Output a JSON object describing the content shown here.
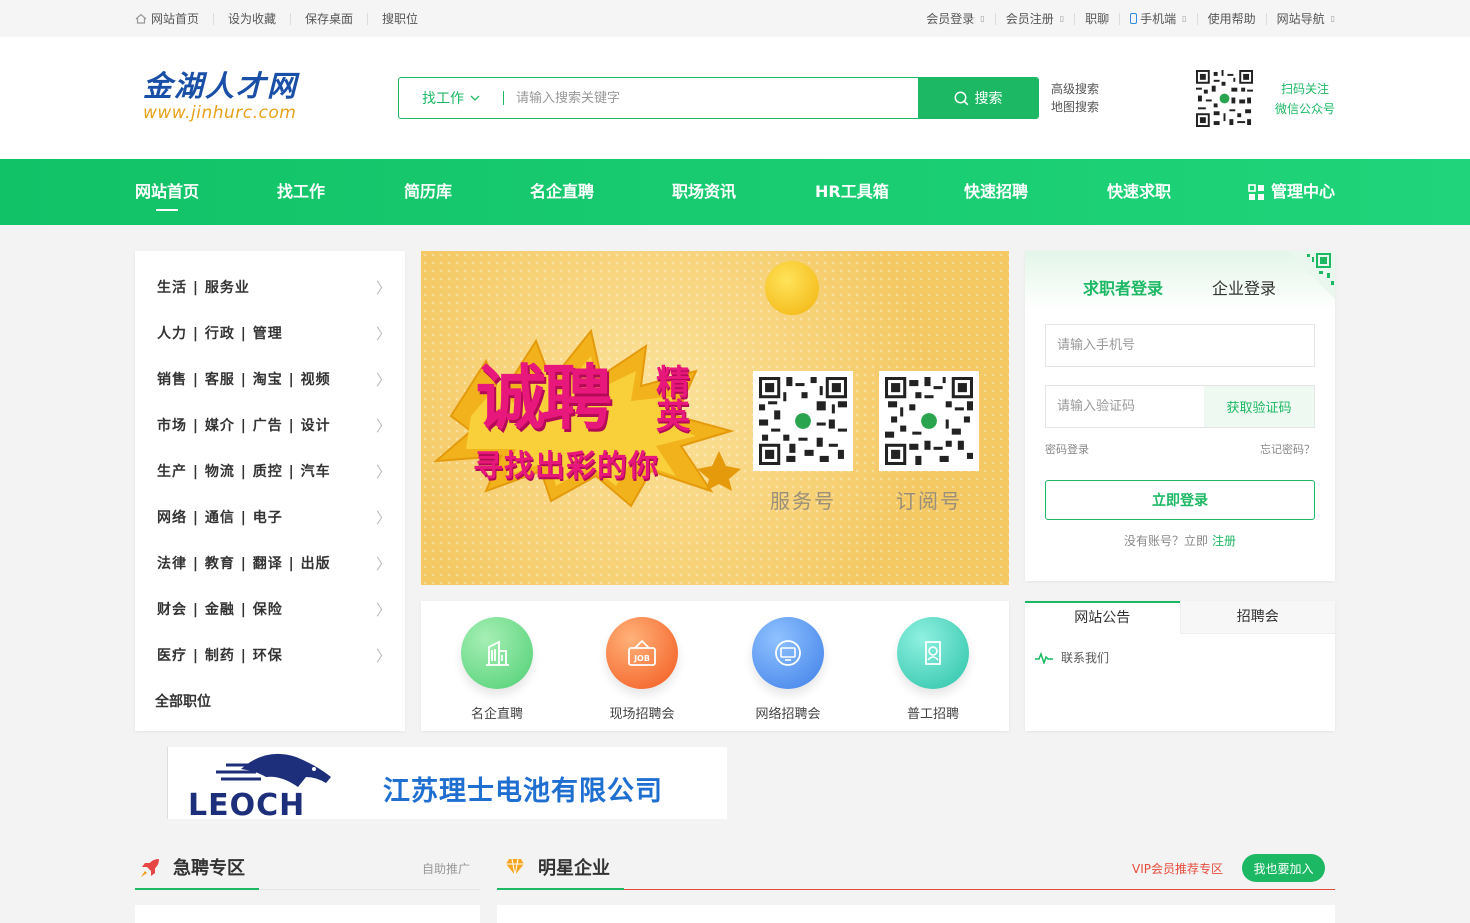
{
  "topbar": {
    "left": [
      "网站首页",
      "设为收藏",
      "保存桌面",
      "搜职位"
    ],
    "right": [
      "会员登录",
      "会员注册",
      "职聊",
      "手机端",
      "使用帮助",
      "网站导航"
    ]
  },
  "logo": {
    "cn": "金湖人才网",
    "en": "www.jinhurc.com"
  },
  "search": {
    "type": "找工作",
    "placeholder": "请输入搜索关键字",
    "button": "搜索",
    "advanced": "高级搜索",
    "map": "地图搜索"
  },
  "scan": {
    "line1": "扫码关注",
    "line2": "微信公众号"
  },
  "nav": [
    "网站首页",
    "找工作",
    "简历库",
    "名企直聘",
    "职场资讯",
    "HR工具箱",
    "快速招聘",
    "快速求职",
    "管理中心"
  ],
  "categories": [
    "生活 | 服务业",
    "人力 | 行政 | 管理",
    "销售 | 客服 | 淘宝 | 视频",
    "市场 | 媒介 | 广告 | 设计",
    "生产 | 物流 | 质控 | 汽车",
    "网络 | 通信 | 电子",
    "法律 | 教育 | 翻译 | 出版",
    "财会 | 金融 | 保险",
    "医疗 | 制药 | 环保"
  ],
  "categories_all": "全部职位",
  "banner": {
    "big1": "诚聘",
    "big2": "精英",
    "big3": "寻找出彩的你",
    "qr1_label": "服务号",
    "qr2_label": "订阅号"
  },
  "login": {
    "tab_seeker": "求职者登录",
    "tab_company": "企业登录",
    "phone_placeholder": "请输入手机号",
    "code_placeholder": "请输入验证码",
    "get_code": "获取验证码",
    "pwd_login": "密码登录",
    "forgot": "忘记密码？",
    "submit": "立即登录",
    "no_account": "没有账号？立即",
    "register": "注册"
  },
  "shortcuts": [
    "名企直聘",
    "现场招聘会",
    "网络招聘会",
    "普工招聘"
  ],
  "notice": {
    "tab1": "网站公告",
    "tab2": "招聘会",
    "item": "联系我们"
  },
  "ad": {
    "company": "江苏理士电池有限公司",
    "brand": "LEOCH"
  },
  "sections": {
    "hot_title": "急聘专区",
    "hot_side": "自助推广",
    "star_title": "明星企业",
    "vip": "VIP会员推荐专区",
    "join": "我也要加入"
  },
  "colors": {
    "brand": "#1cb864",
    "logo_blue": "#1a4fa8",
    "accent_red": "#e74c3c"
  }
}
